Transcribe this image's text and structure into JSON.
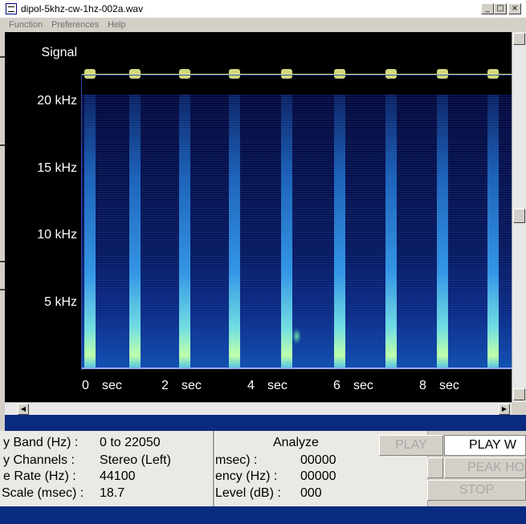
{
  "window": {
    "title": "dipol-5khz-cw-1hz-002a.wav",
    "minimize": "_",
    "maximize": "□",
    "close": "×"
  },
  "menu": [
    "Function",
    "Preferences",
    "Help"
  ],
  "plot": {
    "signal_label": "Signal",
    "freq_labels": [
      "20 kHz",
      "15 kHz",
      "10 kHz",
      "5 kHz"
    ],
    "time_labels": [
      "0",
      "sec",
      "2",
      "sec",
      "4",
      "sec",
      "6",
      "sec",
      "8",
      "sec"
    ],
    "colors": {
      "background": "#000000",
      "signal": "#e8ef8c",
      "spectrum": "#1050b0"
    }
  },
  "info": {
    "labels": [
      "y Band (Hz) :",
      "y Channels :",
      "e Rate (Hz) :",
      "Scale (msec) :"
    ],
    "values": [
      "0 to 22050",
      "Stereo (Left)",
      "44100",
      "18.7"
    ]
  },
  "analyze": {
    "title": "Analyze",
    "labels": [
      "msec) :",
      "ency (Hz) :",
      "Level (dB) :"
    ],
    "values": [
      "00000",
      "00000",
      "000"
    ]
  },
  "buttons": {
    "play": "PLAY",
    "play_w": "PLAY W",
    "peak": "PEAK HO",
    "stop": "STOP"
  }
}
